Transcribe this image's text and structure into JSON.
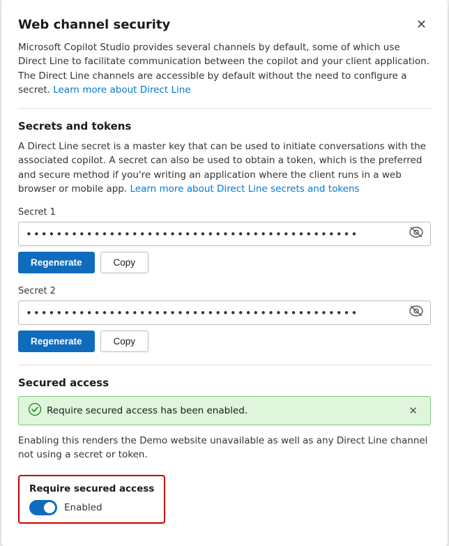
{
  "modal": {
    "title": "Web channel security",
    "close_label": "✕",
    "description": "Microsoft Copilot Studio provides several channels by default, some of which use Direct Line to facilitate communication between the copilot and your client application. The Direct Line channels are accessible by default without the need to configure a secret.",
    "learn_more_link_text": "Learn more about Direct Line",
    "sections": {
      "secrets_tokens": {
        "title": "Secrets and tokens",
        "description": "A Direct Line secret is a master key that can be used to initiate conversations with the associated copilot. A secret can also be used to obtain a token, which is the preferred and secure method if you're writing an application where the client runs in a web browser or mobile app.",
        "learn_more_link_text": "Learn more about Direct Line secrets and tokens",
        "secret1": {
          "label": "Secret 1",
          "dots": "••••••••••••••••••••••••••••••••••••••••••••",
          "regenerate_label": "Regenerate",
          "copy_label": "Copy"
        },
        "secret2": {
          "label": "Secret 2",
          "dots": "••••••••••••••••••••••••••••••••••••••••••••",
          "regenerate_label": "Regenerate",
          "copy_label": "Copy"
        }
      },
      "secured_access": {
        "title": "Secured access",
        "banner_text": "Require secured access has been enabled.",
        "description": "Enabling this renders the Demo website unavailable as well as any Direct Line channel not using a secret or token.",
        "toggle_label": "Require secured access",
        "toggle_state": "Enabled"
      }
    }
  }
}
